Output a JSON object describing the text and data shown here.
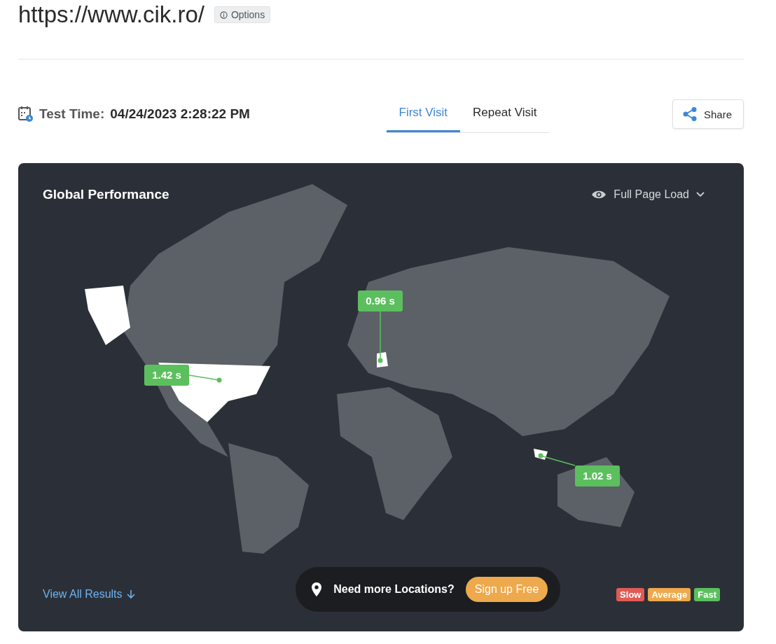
{
  "header": {
    "url": "https://www.cik.ro/",
    "options_button": "Options"
  },
  "test_time": {
    "label": "Test Time:",
    "value": "04/24/2023 2:28:22 PM"
  },
  "tabs": [
    {
      "label": "First Visit",
      "selected": true
    },
    {
      "label": "Repeat Visit",
      "selected": false
    }
  ],
  "share_button": "Share",
  "map_card": {
    "title": "Global Performance",
    "metric_dropdown": "Full Page Load",
    "markers": [
      {
        "label": "1.42 s",
        "color": "#5cbf5e"
      },
      {
        "label": "0.96 s",
        "color": "#5cbf5e"
      },
      {
        "label": "1.02 s",
        "color": "#5cbf5e"
      }
    ],
    "view_all_link": "View All Results",
    "promo": {
      "text": "Need more Locations?",
      "button": "Sign up Free"
    },
    "legend": [
      {
        "label": "Slow",
        "color": "#e05b55"
      },
      {
        "label": "Average",
        "color": "#eda94c"
      },
      {
        "label": "Fast",
        "color": "#5cbf5e"
      }
    ]
  }
}
